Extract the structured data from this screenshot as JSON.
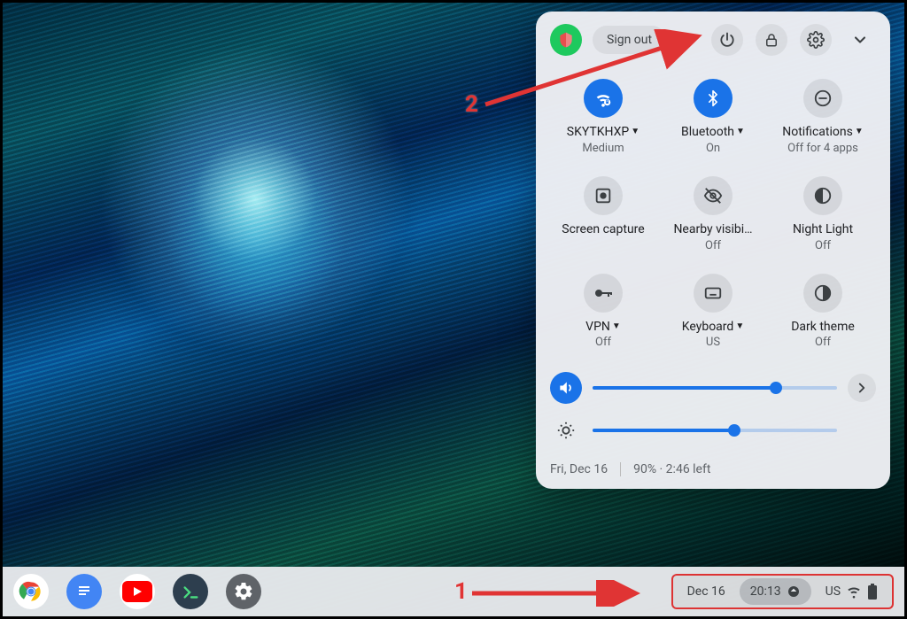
{
  "panel": {
    "signout_label": "Sign out",
    "tiles": {
      "wifi": {
        "label": "SKYTKHXP",
        "sub": "Medium",
        "caret": true
      },
      "bluetooth": {
        "label": "Bluetooth",
        "sub": "On",
        "caret": true
      },
      "notifications": {
        "label": "Notifications",
        "sub": "Off for 4 apps",
        "caret": true
      },
      "screencapture": {
        "label": "Screen capture",
        "sub": ""
      },
      "nearby": {
        "label": "Nearby visibi…",
        "sub": "Off"
      },
      "nightlight": {
        "label": "Night Light",
        "sub": "Off"
      },
      "vpn": {
        "label": "VPN",
        "sub": "Off",
        "caret": true
      },
      "keyboard": {
        "label": "Keyboard",
        "sub": "US",
        "caret": true
      },
      "darktheme": {
        "label": "Dark theme",
        "sub": "Off"
      }
    },
    "volume_percent": 75,
    "brightness_percent": 58,
    "footer": {
      "date": "Fri, Dec 16",
      "battery": "90% · 2:46 left"
    }
  },
  "shelf": {
    "status": {
      "date": "Dec 16",
      "time": "20:13",
      "ime": "US"
    }
  },
  "annotations": {
    "one": "1",
    "two": "2"
  }
}
